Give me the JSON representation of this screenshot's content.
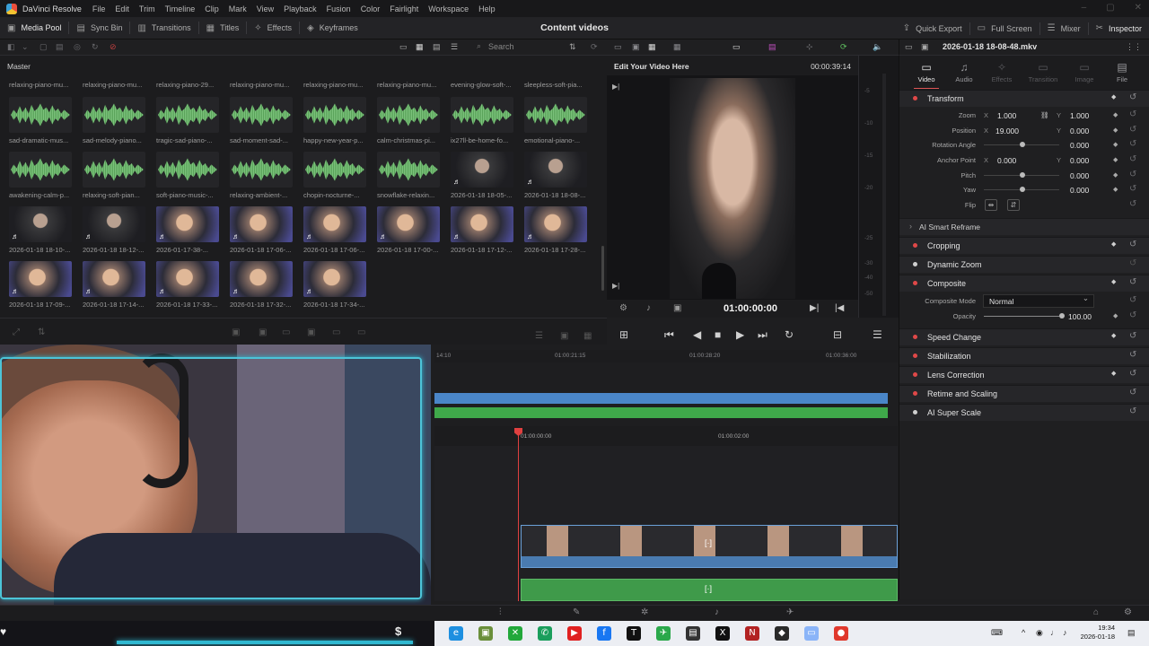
{
  "app": {
    "name": "DaVinci Resolve",
    "project_title": "Content videos"
  },
  "menu": [
    "File",
    "Edit",
    "Trim",
    "Timeline",
    "Clip",
    "Mark",
    "View",
    "Playback",
    "Fusion",
    "Color",
    "Fairlight",
    "Workspace",
    "Help"
  ],
  "toolbar": {
    "media_pool": "Media Pool",
    "sync_bin": "Sync Bin",
    "transitions": "Transitions",
    "titles": "Titles",
    "effects": "Effects",
    "keyframes": "Keyframes",
    "quick_export": "Quick Export",
    "full_screen": "Full Screen",
    "mixer": "Mixer",
    "inspector": "Inspector"
  },
  "media_pool": {
    "search_placeholder": "Search",
    "bin": "Master",
    "top_labels": [
      "relaxing-piano-mu...",
      "relaxing-piano-mu...",
      "relaxing-piano-29...",
      "relaxing-piano-mu...",
      "relaxing-piano-mu...",
      "relaxing-piano-mu...",
      "evening-glow-soft-...",
      "sleepless-soft-pia..."
    ],
    "rows": [
      [
        {
          "label": "sad-dramatic-mus...",
          "kind": "audio"
        },
        {
          "label": "sad-melody-piano...",
          "kind": "audio"
        },
        {
          "label": "tragic-sad-piano-...",
          "kind": "audio"
        },
        {
          "label": "sad-moment-sad-...",
          "kind": "audio"
        },
        {
          "label": "happy-new-year-p...",
          "kind": "audio"
        },
        {
          "label": "calm-christmas-pi...",
          "kind": "audio"
        },
        {
          "label": "ix27ll-be-home-fo...",
          "kind": "audio"
        },
        {
          "label": "emotional-piano-...",
          "kind": "audio"
        }
      ],
      [
        {
          "label": "awakening-calm-p...",
          "kind": "audio"
        },
        {
          "label": "relaxing-soft-pian...",
          "kind": "audio"
        },
        {
          "label": "soft-piano-music-...",
          "kind": "audio"
        },
        {
          "label": "relaxing-ambient-...",
          "kind": "audio"
        },
        {
          "label": "chopin-nocturne-...",
          "kind": "audio"
        },
        {
          "label": "snowflake-relaxin...",
          "kind": "audio"
        },
        {
          "label": "2026-01-18 18-05-...",
          "kind": "video-dark"
        },
        {
          "label": "2026-01-18 18-08-...",
          "kind": "video-dark"
        }
      ],
      [
        {
          "label": "2026-01-18 18-10-...",
          "kind": "video-dark"
        },
        {
          "label": "2026-01-18 18-12-...",
          "kind": "video-dark"
        },
        {
          "label": "2026-01-17-38-...",
          "kind": "video-lit"
        },
        {
          "label": "2026-01-18 17-06-...",
          "kind": "video-lit"
        },
        {
          "label": "2026-01-18 17-06-...",
          "kind": "video-lit"
        },
        {
          "label": "2026-01-18 17-00-...",
          "kind": "video-lit"
        },
        {
          "label": "2026-01-18 17-12-...",
          "kind": "video-lit"
        },
        {
          "label": "2026-01-18 17-28-...",
          "kind": "video-lit"
        }
      ],
      [
        {
          "label": "2026-01-18 17-09-...",
          "kind": "video-lit"
        },
        {
          "label": "2026-01-18 17-14-...",
          "kind": "video-lit"
        },
        {
          "label": "2026-01-18 17-33-...",
          "kind": "video-lit"
        },
        {
          "label": "2026-01-18 17-32-...",
          "kind": "video-lit"
        },
        {
          "label": "2026-01-18 17-34-...",
          "kind": "video-lit"
        }
      ]
    ]
  },
  "viewer": {
    "title": "Edit Your Video Here",
    "duration": "00:00:39:14",
    "timecode": "01:00:00:00",
    "meter_ticks": [
      "-5",
      "-10",
      "-15",
      "-20",
      "-25",
      "-30",
      "-40",
      "-50"
    ]
  },
  "inspector": {
    "file": "2026-01-18 18-08-48.mkv",
    "tabs": [
      {
        "label": "Video",
        "icon": "film-icon"
      },
      {
        "label": "Audio",
        "icon": "music-icon"
      },
      {
        "label": "Effects",
        "icon": "wand-icon"
      },
      {
        "label": "Transition",
        "icon": "transition-icon"
      },
      {
        "label": "Image",
        "icon": "image-icon"
      },
      {
        "label": "File",
        "icon": "file-icon"
      }
    ],
    "transform": {
      "title": "Transform",
      "zoom_label": "Zoom",
      "zoom_x": "1.000",
      "zoom_y": "1.000",
      "position_label": "Position",
      "position_x": "19.000",
      "position_y": "0.000",
      "rotation_label": "Rotation Angle",
      "rotation": "0.000",
      "anchor_label": "Anchor Point",
      "anchor_x": "0.000",
      "anchor_y": "0.000",
      "pitch_label": "Pitch",
      "pitch": "0.000",
      "yaw_label": "Yaw",
      "yaw": "0.000",
      "flip_label": "Flip",
      "axis_x": "X",
      "axis_y": "Y"
    },
    "smart_reframe": "AI Smart Reframe",
    "cropping": "Cropping",
    "dynamic_zoom": "Dynamic Zoom",
    "composite": {
      "title": "Composite",
      "mode_label": "Composite Mode",
      "mode": "Normal",
      "opacity_label": "Opacity",
      "opacity": "100.00"
    },
    "sections": [
      "Speed Change",
      "Stabilization",
      "Lens Correction",
      "Retime and Scaling",
      "AI Super Scale"
    ]
  },
  "timeline": {
    "upper_ticks": [
      "14:10",
      "01:00:21:15",
      "01:00:28:20",
      "01:00:36:00"
    ],
    "lower_ticks": [
      "01:00:00:00",
      "01:00:02:00"
    ]
  },
  "taskbar": {
    "time": "19:34",
    "date": "2026-01-18",
    "apps": [
      {
        "name": "edge-icon",
        "color": "#1d8fe0",
        "glyph": "e"
      },
      {
        "name": "minecraft-icon",
        "color": "#6a8f3a",
        "glyph": "▣"
      },
      {
        "name": "xbox-icon",
        "color": "#22a83a",
        "glyph": "✕"
      },
      {
        "name": "phone-icon",
        "color": "#1a9e5c",
        "glyph": "✆"
      },
      {
        "name": "youtube-icon",
        "color": "#e02020",
        "glyph": "▶"
      },
      {
        "name": "facebook-icon",
        "color": "#1877f2",
        "glyph": "f"
      },
      {
        "name": "tidal-icon",
        "color": "#111111",
        "glyph": "T"
      },
      {
        "name": "bird-app-icon",
        "color": "#2aa84a",
        "glyph": "✈"
      },
      {
        "name": "terminal-icon",
        "color": "#333333",
        "glyph": "▤"
      },
      {
        "name": "capcut-icon",
        "color": "#111111",
        "glyph": "X"
      },
      {
        "name": "notion-icon",
        "color": "#b22222",
        "glyph": "N"
      },
      {
        "name": "camera-app-icon",
        "color": "#2a2a2a",
        "glyph": "◆"
      },
      {
        "name": "files-icon",
        "color": "#8ab4f8",
        "glyph": "▭"
      },
      {
        "name": "resolve-icon",
        "color": "#e0382c",
        "glyph": "●"
      }
    ]
  }
}
